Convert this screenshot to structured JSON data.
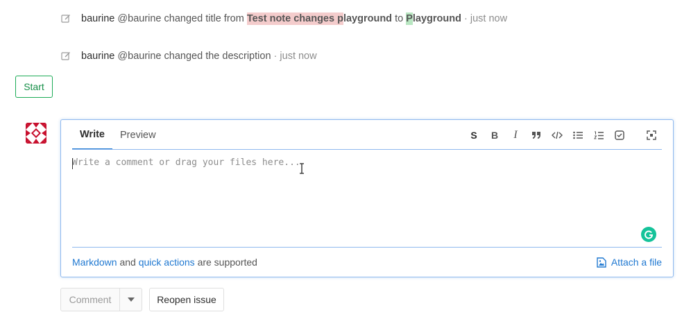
{
  "notes": [
    {
      "author": "baurine",
      "handle": "@baurine",
      "action": "changed title from",
      "old_title_deleted": "Test note changes p",
      "old_title_rest": "layground",
      "connector": "to",
      "new_title_inserted": "P",
      "new_title_rest": "layground",
      "time": "· just now",
      "icon": "pencil-square-icon"
    },
    {
      "author": "baurine",
      "handle": "@baurine",
      "action": "changed the description",
      "time": "· just now",
      "icon": "pencil-square-icon"
    }
  ],
  "start_button": {
    "label": "Start",
    "color": "#1aaa55"
  },
  "editor": {
    "tabs": [
      {
        "label": "Write",
        "active": true
      },
      {
        "label": "Preview",
        "active": false
      }
    ],
    "toolbar": [
      {
        "label": "S",
        "icon": "strikethrough-icon"
      },
      {
        "label": "B",
        "icon": "bold-icon"
      },
      {
        "label": "I",
        "icon": "italic-icon"
      },
      {
        "icon": "quote-icon"
      },
      {
        "icon": "code-icon"
      },
      {
        "icon": "bullet-list-icon"
      },
      {
        "icon": "numbered-list-icon"
      },
      {
        "icon": "task-list-icon"
      },
      {
        "icon": "fullscreen-icon"
      }
    ],
    "placeholder": "Write a comment or drag your files here...",
    "value": "",
    "footer": {
      "markdown_link": "Markdown",
      "and": "and",
      "quick_actions_link": "quick actions",
      "supported": "are supported",
      "attach_label": "Attach a file"
    }
  },
  "actions": {
    "comment_label": "Comment",
    "reopen_label": "Reopen issue"
  },
  "colors": {
    "link": "#1f78d1",
    "success": "#1aaa55",
    "deleted_highlight": "#f4cccc",
    "inserted_highlight": "#b8e6c1",
    "grammarly": "#15c39a",
    "avatar": "#c8102e"
  }
}
